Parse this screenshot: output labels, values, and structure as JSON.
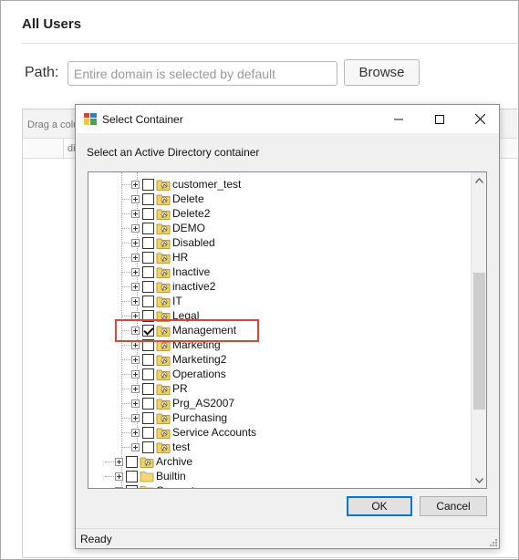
{
  "page": {
    "title": "All Users",
    "path_label": "Path:",
    "path_placeholder": "Entire domain is selected by default",
    "path_value": "",
    "browse_label": "Browse",
    "grid_group_hint": "Drag a column",
    "grid_column_first": "dis"
  },
  "dialog": {
    "title": "Select Container",
    "instruction": "Select an Active Directory container",
    "ok_label": "OK",
    "cancel_label": "Cancel",
    "status": "Ready"
  },
  "tree": {
    "children": [
      {
        "label": "customer_test",
        "checked": false
      },
      {
        "label": "Delete",
        "checked": false
      },
      {
        "label": "Delete2",
        "checked": false
      },
      {
        "label": "DEMO",
        "checked": false
      },
      {
        "label": "Disabled",
        "checked": false
      },
      {
        "label": "HR",
        "checked": false
      },
      {
        "label": "Inactive",
        "checked": false
      },
      {
        "label": "inactive2",
        "checked": false
      },
      {
        "label": "IT",
        "checked": false
      },
      {
        "label": "Legal",
        "checked": false
      },
      {
        "label": "Management",
        "checked": true
      },
      {
        "label": "Marketing",
        "checked": false
      },
      {
        "label": "Marketing2",
        "checked": false
      },
      {
        "label": "Operations",
        "checked": false
      },
      {
        "label": "PR",
        "checked": false
      },
      {
        "label": "Prg_AS2007",
        "checked": false
      },
      {
        "label": "Purchasing",
        "checked": false
      },
      {
        "label": "Service Accounts",
        "checked": false
      },
      {
        "label": "test",
        "checked": false
      }
    ],
    "top_level": [
      {
        "label": "Archive",
        "checked": false,
        "icon": "ou"
      },
      {
        "label": "Builtin",
        "checked": false,
        "icon": "folder"
      },
      {
        "label": "Computers",
        "checked": false,
        "icon": "folder"
      }
    ]
  },
  "colors": {
    "highlight": "#e0433a",
    "ou_yellow": "#f2d35a",
    "folder_yellow": "#f5d773",
    "button_focus": "#0078d7"
  },
  "icons": {
    "app": "container-app-icon",
    "minimize": "minimize-icon",
    "maximize": "maximize-icon",
    "close": "close-icon",
    "ou": "ou-folder-icon",
    "folder": "folder-icon"
  }
}
